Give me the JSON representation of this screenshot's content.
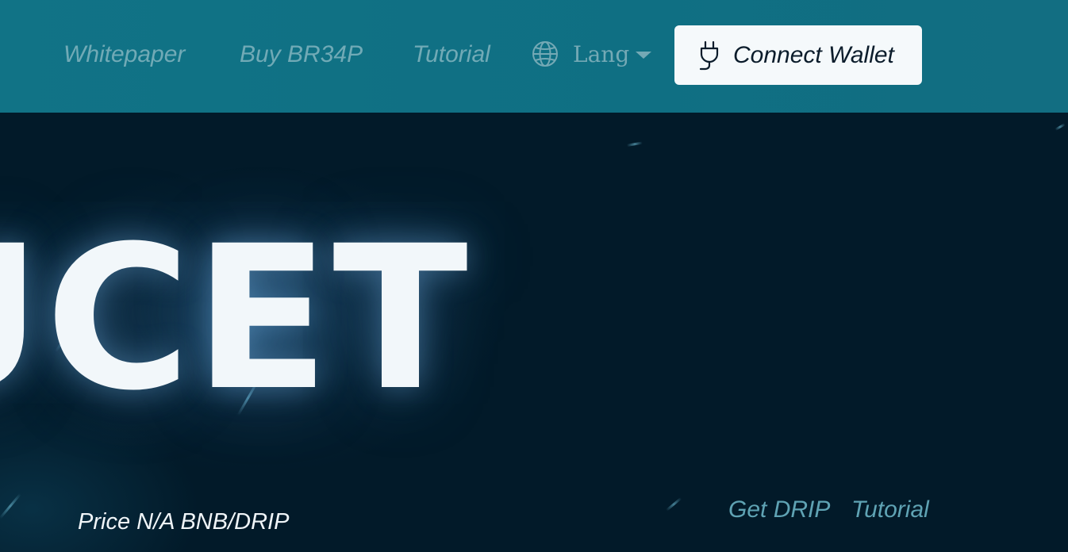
{
  "header": {
    "nav": [
      {
        "label": "Whitepaper"
      },
      {
        "label": "Buy BR34P"
      },
      {
        "label": "Tutorial"
      }
    ],
    "lang_label": "Lang",
    "connect_label": "Connect Wallet",
    "icons": {
      "lang": "globe-icon",
      "lang_caret": "caret-down-icon",
      "connect": "plug-icon"
    }
  },
  "hero": {
    "title_visible": "UCET",
    "price_text": "Price N/A BNB/DRIP",
    "links": [
      {
        "label": "Get DRIP"
      },
      {
        "label": "Tutorial"
      }
    ]
  },
  "colors": {
    "header_bg": "#117386",
    "nav_text": "#71aab6",
    "button_bg": "#f5f9fb",
    "button_text": "#0b1c2b",
    "hero_bg": "#021a29",
    "hero_link": "#5fa3b4",
    "hero_title": "#f2f7fa"
  }
}
